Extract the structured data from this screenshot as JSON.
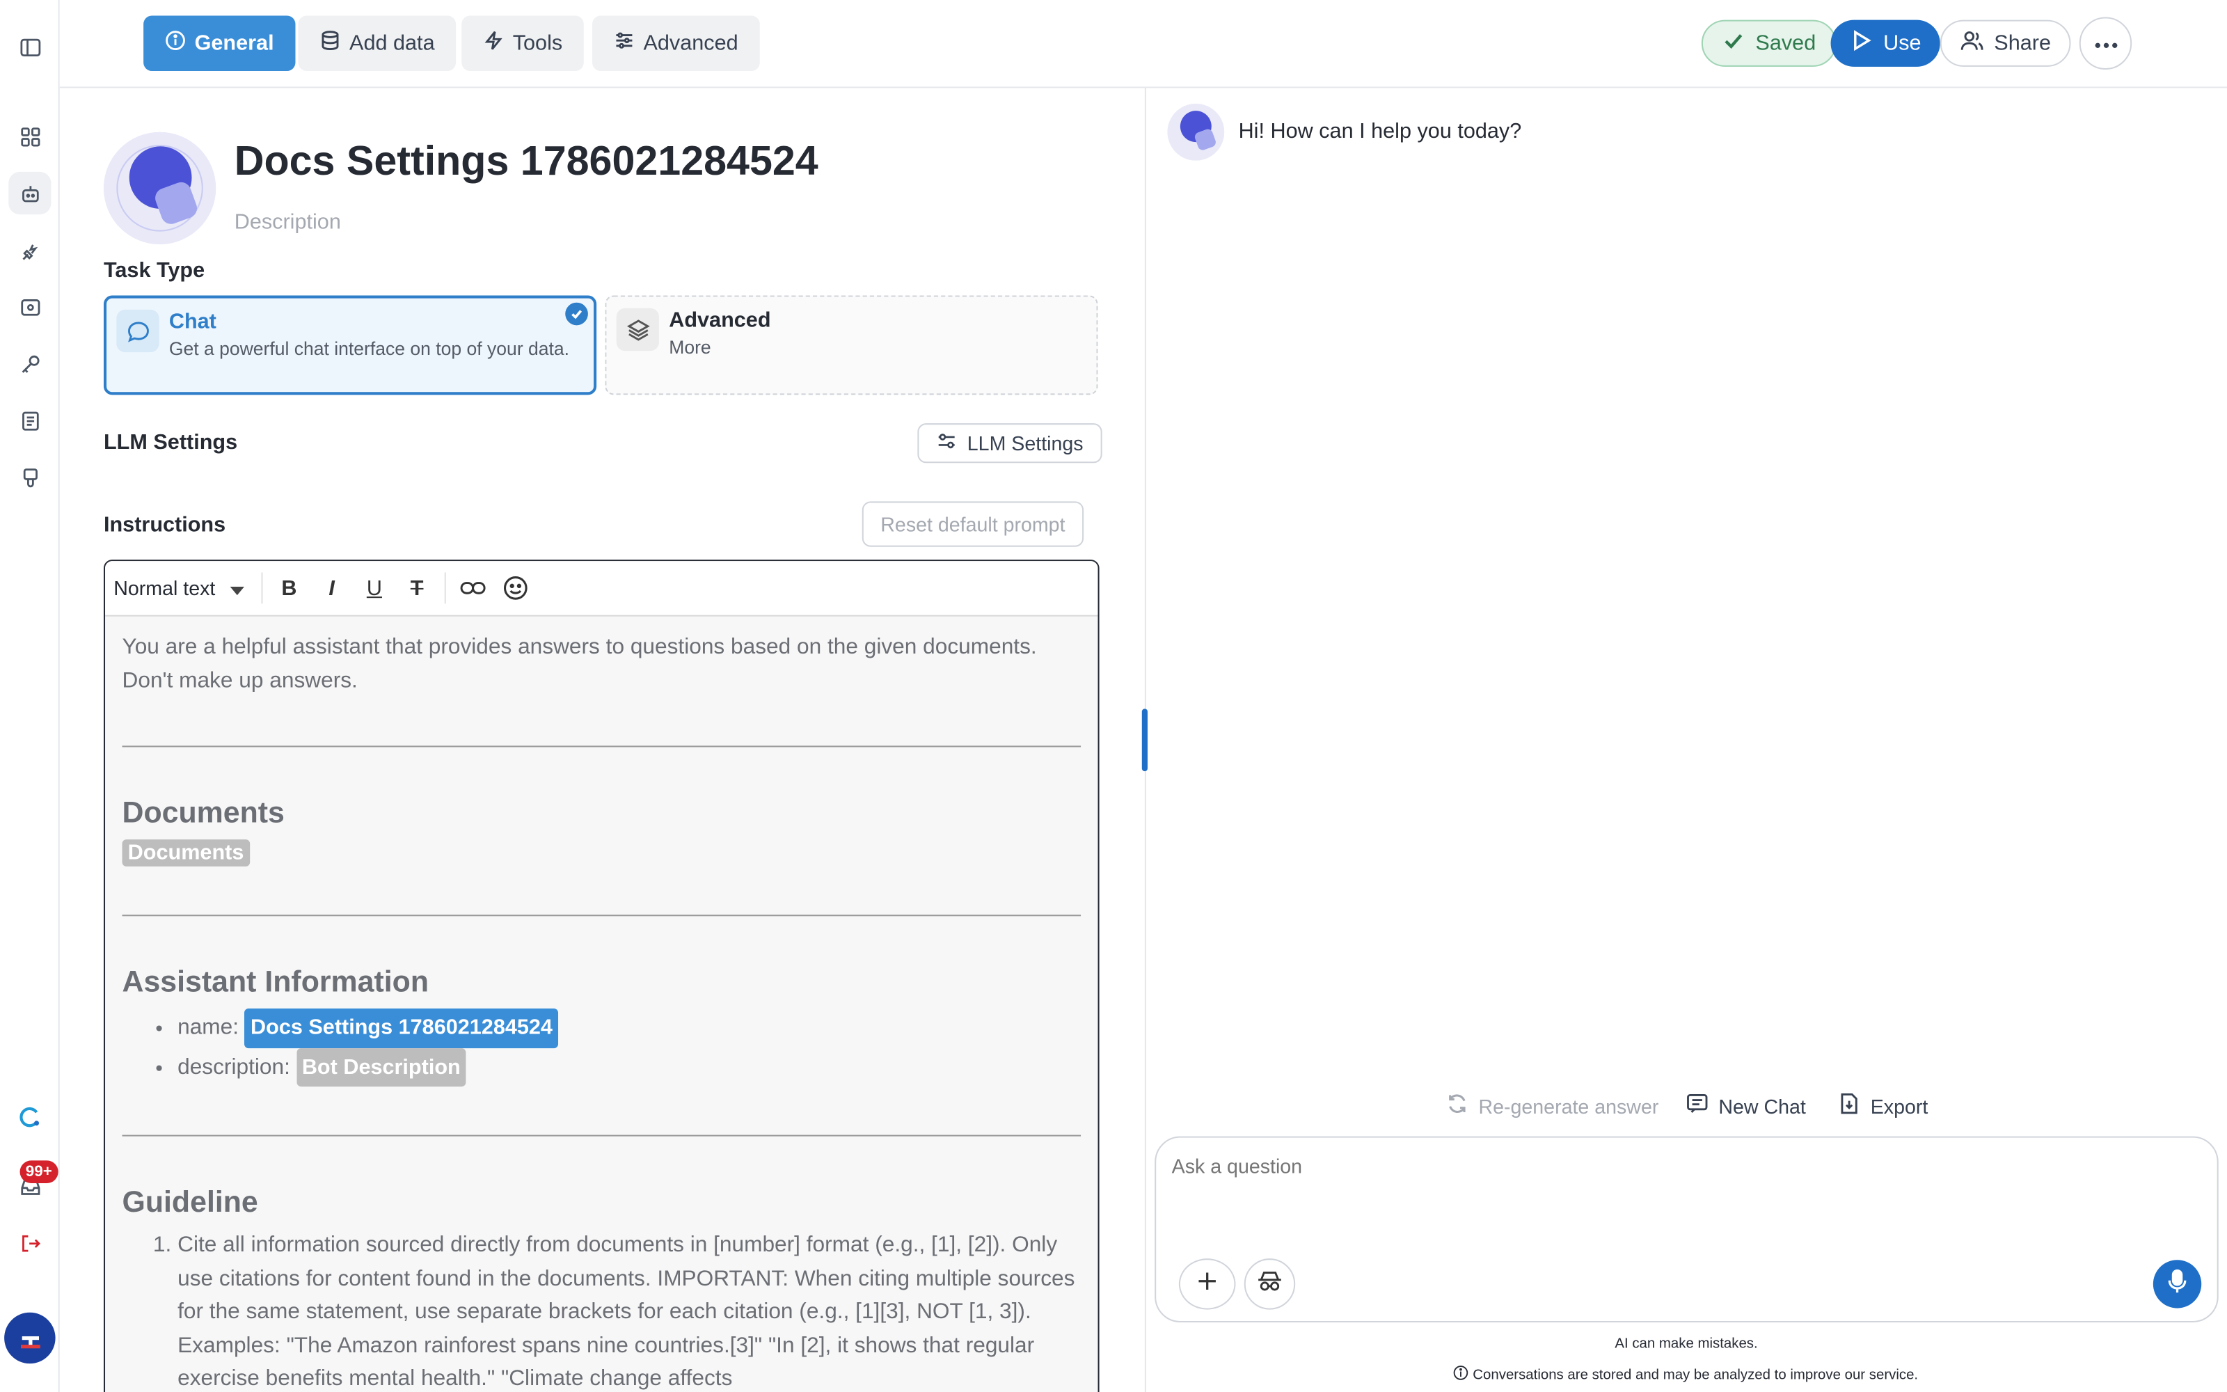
{
  "tabs": [
    {
      "label": "General",
      "icon": "info-icon",
      "active": true
    },
    {
      "label": "Add data",
      "icon": "database-icon",
      "active": false
    },
    {
      "label": "Tools",
      "icon": "lightning-icon",
      "active": false
    },
    {
      "label": "Advanced",
      "icon": "sliders-icon",
      "active": false
    }
  ],
  "header": {
    "saved_label": "Saved",
    "use_label": "Use",
    "share_label": "Share"
  },
  "sidebar": {
    "badge": "99+",
    "icons": [
      "panel-toggle-icon",
      "grid-icon",
      "bot-icon",
      "plug-icon",
      "scan-icon",
      "key-icon",
      "document-icon",
      "brush-icon",
      "app-logo-icon",
      "inbox-icon",
      "logout-icon",
      "user-avatar-icon"
    ]
  },
  "assistant": {
    "name": "Docs Settings 1786021284524",
    "description_placeholder": "Description"
  },
  "task_type": {
    "label": "Task Type",
    "options": [
      {
        "title": "Chat",
        "subtitle": "Get a powerful chat interface on top of your data.",
        "selected": true
      },
      {
        "title": "Advanced",
        "subtitle": "More",
        "selected": false
      }
    ]
  },
  "llm": {
    "label": "LLM Settings",
    "button": "LLM Settings"
  },
  "instructions": {
    "label": "Instructions",
    "reset_button": "Reset default prompt",
    "text_style": "Normal text",
    "intro_line1": "You are a helpful assistant that provides answers to questions based on the given documents.",
    "intro_line2": "Don't make up answers.",
    "documents_heading": "Documents",
    "documents_chip": "Documents",
    "assistant_info_heading": "Assistant Information",
    "name_label": "name:",
    "name_chip": "Docs Settings 1786021284524",
    "description_label": "description:",
    "description_chip": "Bot Description",
    "guideline_heading": "Guideline",
    "guideline_1": "Cite all information sourced directly from documents in [number] format (e.g., [1], [2]). Only use citations for content found in the documents. IMPORTANT: When citing multiple sources for the same statement, use separate brackets for each citation (e.g., [1][3], NOT [1, 3]). Examples: \"The Amazon rainforest spans nine countries.[3]\" \"In [2], it shows that regular exercise benefits mental health.\" \"Climate change affects"
  },
  "chat": {
    "greeting": "Hi! How can I help you today?",
    "regenerate": "Re-generate answer",
    "new_chat": "New Chat",
    "export": "Export",
    "input_placeholder": "Ask a question",
    "disclaimer": "AI can make mistakes.",
    "privacy_note": "Conversations are stored and may be analyzed to improve our service."
  },
  "colors": {
    "accent": "#1f6fc8",
    "tab_active": "#3a8ed8",
    "saved_green": "#2f7a4d",
    "badge_red": "#d4212b"
  }
}
